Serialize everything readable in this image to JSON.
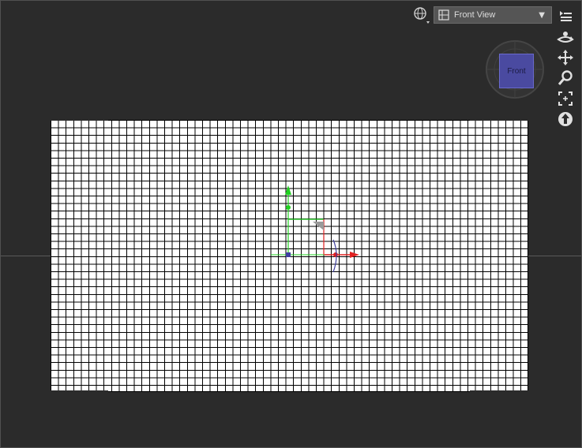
{
  "toolbar": {
    "view_selector": {
      "label": "Front View"
    },
    "environment_icon": "globe-icon",
    "menu_icon": "list-menu-icon"
  },
  "side_tools": [
    {
      "name": "orbit-icon"
    },
    {
      "name": "pan-icon"
    },
    {
      "name": "zoom-icon"
    },
    {
      "name": "frame-icon"
    },
    {
      "name": "reset-icon"
    }
  ],
  "nav_cube": {
    "face_label": "Front"
  },
  "colors": {
    "background": "#2b2b2b",
    "mesh": "#ffffff",
    "grid_lines": "#000000",
    "axis_x": "#e02020",
    "axis_y": "#20d020",
    "axis_z": "#4040a0",
    "nav_face": "#4a4aa0"
  }
}
